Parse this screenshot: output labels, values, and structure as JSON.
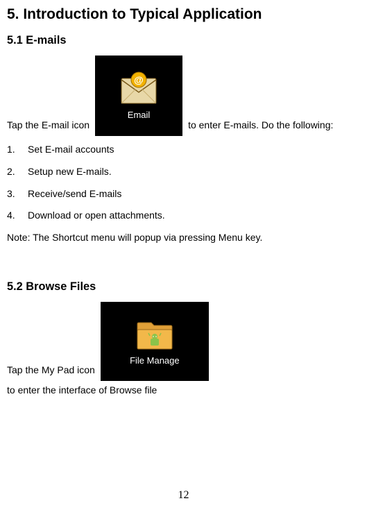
{
  "heading": "5. Introduction to Typical Application",
  "section_email": {
    "title": "5.1 E-mails",
    "prefix": "Tap the E-mail icon",
    "icon_label": "Email",
    "suffix": "to enter E-mails. Do the following:",
    "steps": [
      {
        "num": "1.",
        "text": "Set E-mail accounts"
      },
      {
        "num": "2.",
        "text": "Setup new E-mails."
      },
      {
        "num": "3.",
        "text": "Receive/send E-mails"
      },
      {
        "num": "4.",
        "text": "Download or open attachments."
      }
    ],
    "note": "Note: The Shortcut menu will popup via pressing Menu key."
  },
  "section_files": {
    "title": "5.2 Browse Files",
    "prefix": "Tap the My Pad icon",
    "icon_label": "File Manage",
    "suffix": "to enter the interface of Browse file"
  },
  "page_number": "12"
}
